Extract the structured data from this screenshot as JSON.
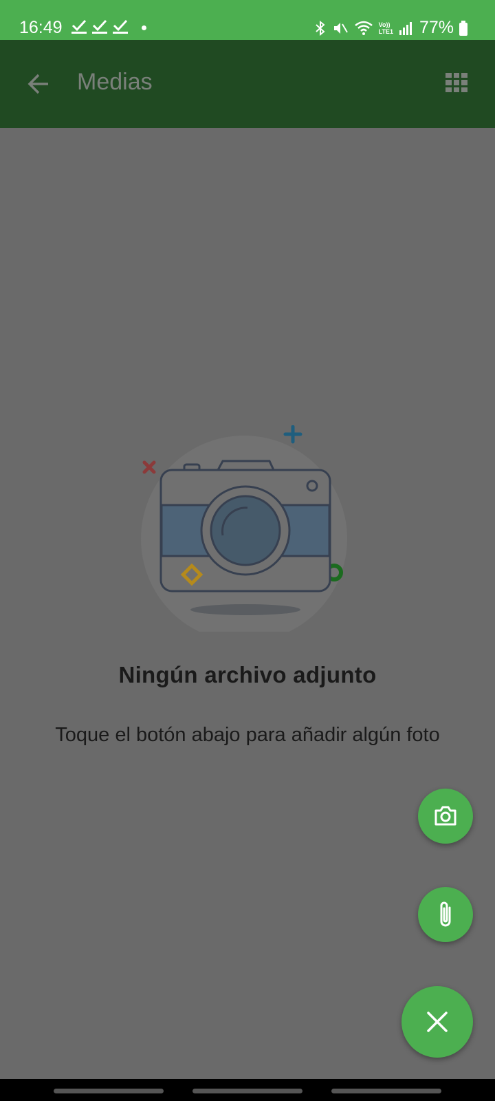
{
  "status_bar": {
    "time": "16:49",
    "battery": "77%",
    "icons": [
      "check-icon",
      "check-icon",
      "check-icon",
      "dot-icon",
      "bluetooth-icon",
      "mute-icon",
      "wifi-icon",
      "volte-icon",
      "signal-icon",
      "battery-icon"
    ],
    "volte_top": "Vo))",
    "volte_bottom": "LTE1",
    "color": "#4caf50"
  },
  "app_bar": {
    "title": "Medias",
    "back_icon": "arrow-left-icon",
    "view_icon": "grid-icon",
    "color": "#204a22"
  },
  "empty_state": {
    "illustration": "camera-illustration",
    "title": "Ningún archivo adjunto",
    "description": "Toque el botón abajo para añadir algún foto"
  },
  "fabs": {
    "camera_icon": "camera-icon",
    "attach_icon": "paperclip-icon",
    "close_icon": "close-icon",
    "color": "#4caf50"
  },
  "colors": {
    "scrim": "#6a6a6a",
    "accent": "#4caf50"
  }
}
